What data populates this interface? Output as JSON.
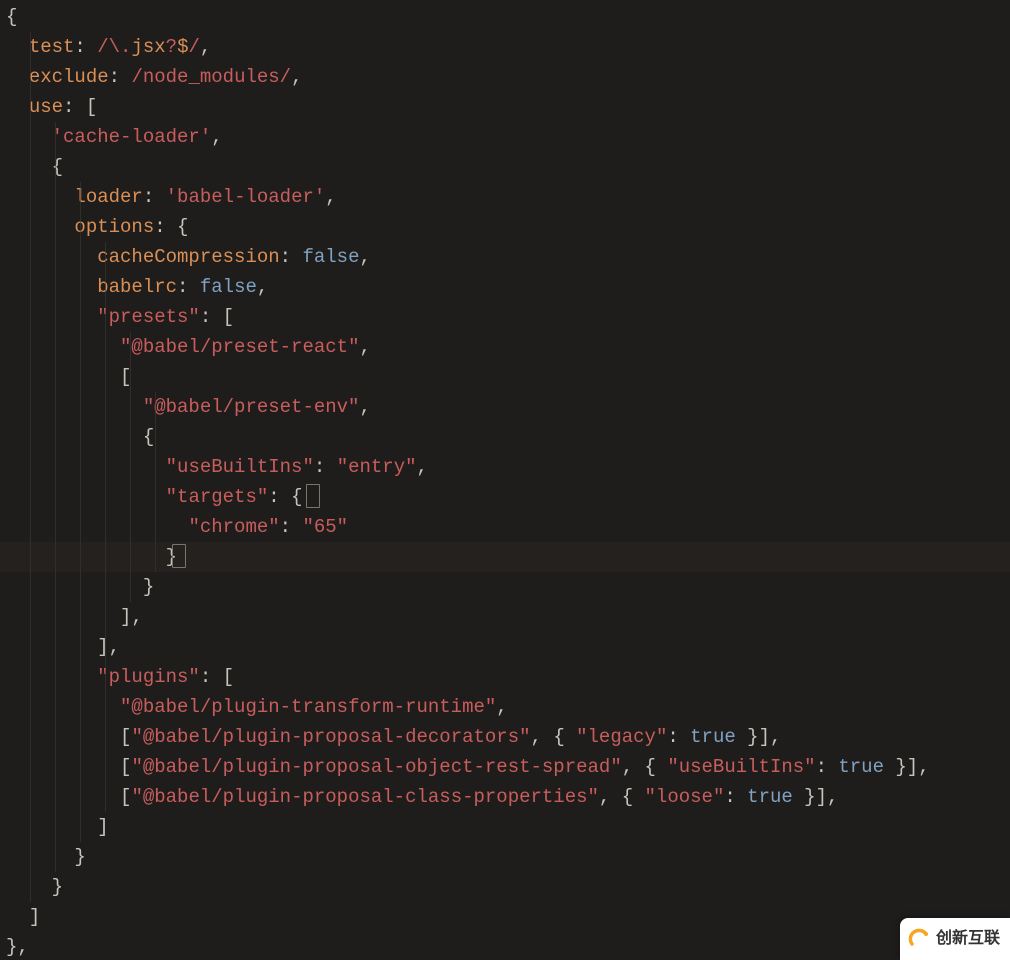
{
  "editor": {
    "filetype": "javascript",
    "highlighted_line_index": 18
  },
  "tokens": {
    "open_brace": "{",
    "close_brace": "}",
    "open_bracket": "[",
    "close_bracket": "]",
    "comma": ",",
    "colon": ":",
    "test": "test",
    "test_regex": "/\\.jsx?$/",
    "exclude": "exclude",
    "exclude_regex": "/node_modules/",
    "use": "use",
    "cache_loader": "'cache-loader'",
    "loader_key": "loader",
    "loader_val": "'babel-loader'",
    "options": "options",
    "cacheCompression": "cacheCompression",
    "false": "false",
    "babelrc": "babelrc",
    "presets_key": "\"presets\"",
    "preset_react": "\"@babel/preset-react\"",
    "preset_env": "\"@babel/preset-env\"",
    "useBuiltIns_key": "\"useBuiltIns\"",
    "entry_val": "\"entry\"",
    "targets_key": "\"targets\"",
    "chrome_key": "\"chrome\"",
    "chrome_val": "\"65\"",
    "plugins_key": "\"plugins\"",
    "plugin_runtime": "\"@babel/plugin-transform-runtime\"",
    "plugin_decorators": "\"@babel/plugin-proposal-decorators\"",
    "legacy_key": "\"legacy\"",
    "true": "true",
    "plugin_spread": "\"@babel/plugin-proposal-object-rest-spread\"",
    "useBuiltIns_key2": "\"useBuiltIns\"",
    "plugin_class": "\"@babel/plugin-proposal-class-properties\"",
    "loose_key": "\"loose\""
  },
  "badge": {
    "text": "创新互联"
  }
}
